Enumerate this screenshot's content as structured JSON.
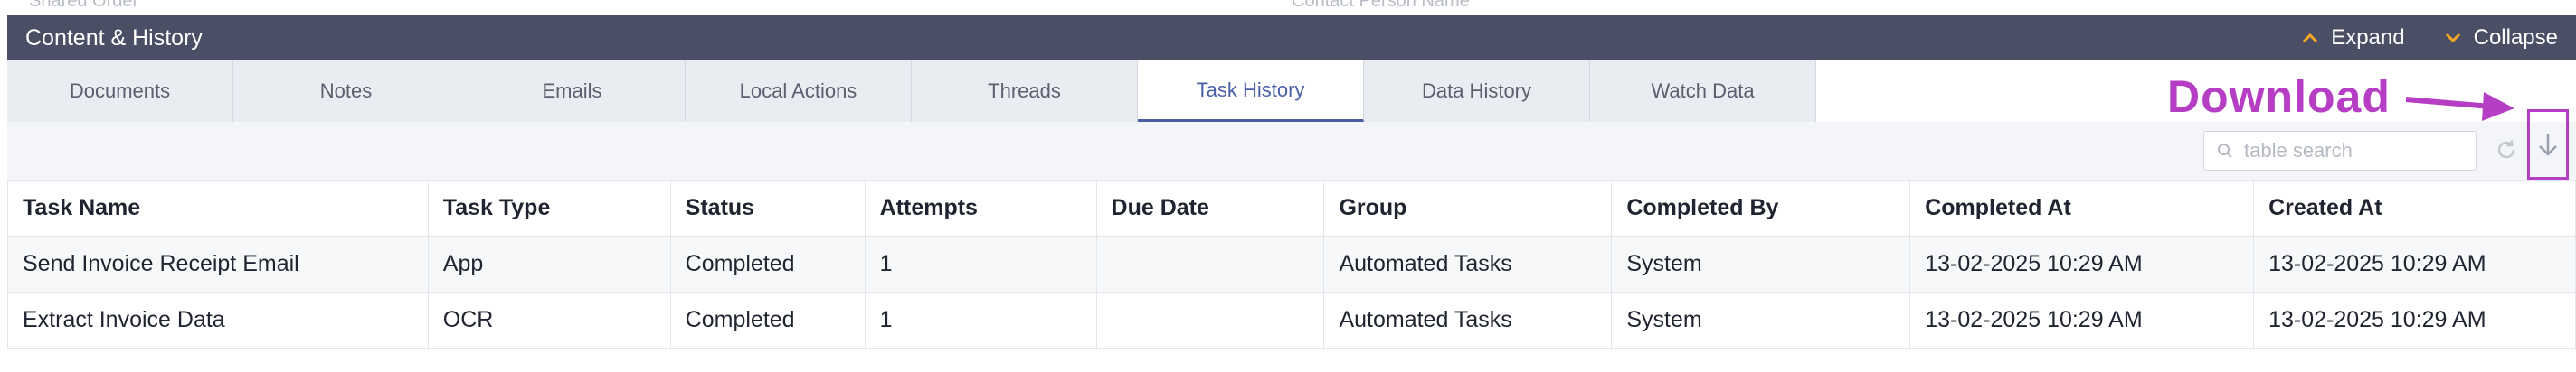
{
  "top_strip": {
    "left_text": "Shared Order",
    "right_text": "Contact Person Name"
  },
  "header": {
    "title": "Content & History",
    "expand_label": "Expand",
    "collapse_label": "Collapse"
  },
  "tabs": [
    {
      "label": "Documents",
      "active": false
    },
    {
      "label": "Notes",
      "active": false
    },
    {
      "label": "Emails",
      "active": false
    },
    {
      "label": "Local Actions",
      "active": false
    },
    {
      "label": "Threads",
      "active": false
    },
    {
      "label": "Task History",
      "active": true
    },
    {
      "label": "Data History",
      "active": false
    },
    {
      "label": "Watch Data",
      "active": false
    }
  ],
  "toolbar": {
    "search_placeholder": "table search",
    "search_value": ""
  },
  "annotation": {
    "label": "Download",
    "color": "#b53ec4"
  },
  "table": {
    "columns": [
      "Task Name",
      "Task Type",
      "Status",
      "Attempts",
      "Due Date",
      "Group",
      "Completed By",
      "Completed At",
      "Created At"
    ],
    "rows": [
      [
        "Send Invoice Receipt Email",
        "App",
        "Completed",
        "1",
        "",
        "Automated Tasks",
        "System",
        "13-02-2025 10:29 AM",
        "13-02-2025 10:29 AM"
      ],
      [
        "Extract Invoice Data",
        "OCR",
        "Completed",
        "1",
        "",
        "Automated Tasks",
        "System",
        "13-02-2025 10:29 AM",
        "13-02-2025 10:29 AM"
      ]
    ]
  },
  "colors": {
    "header_bg": "#4b4f66",
    "active_tab": "#4a5fa8",
    "tab_bg": "#e9ecf1",
    "annotation": "#b53ec4"
  }
}
